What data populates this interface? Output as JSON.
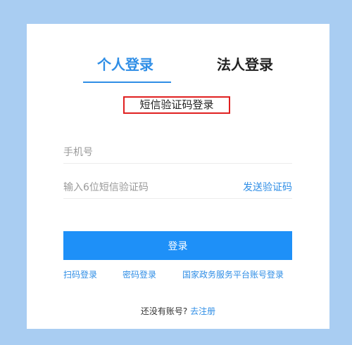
{
  "tabs": {
    "personal": "个人登录",
    "legal": "法人登录"
  },
  "login_method": "短信验证码登录",
  "fields": {
    "phone_placeholder": "手机号",
    "code_placeholder": "输入6位短信验证码",
    "send_code": "发送验证码"
  },
  "login_button": "登录",
  "alt_links": {
    "scan": "扫码登录",
    "password": "密码登录",
    "national_platform": "国家政务服务平台账号登录"
  },
  "register": {
    "prompt": "还没有账号?",
    "link": "去注册"
  },
  "colors": {
    "page_background": "#a9cdf2",
    "accent": "#2f8ee6",
    "button": "#1e90f8",
    "highlight_border": "#e02020"
  }
}
